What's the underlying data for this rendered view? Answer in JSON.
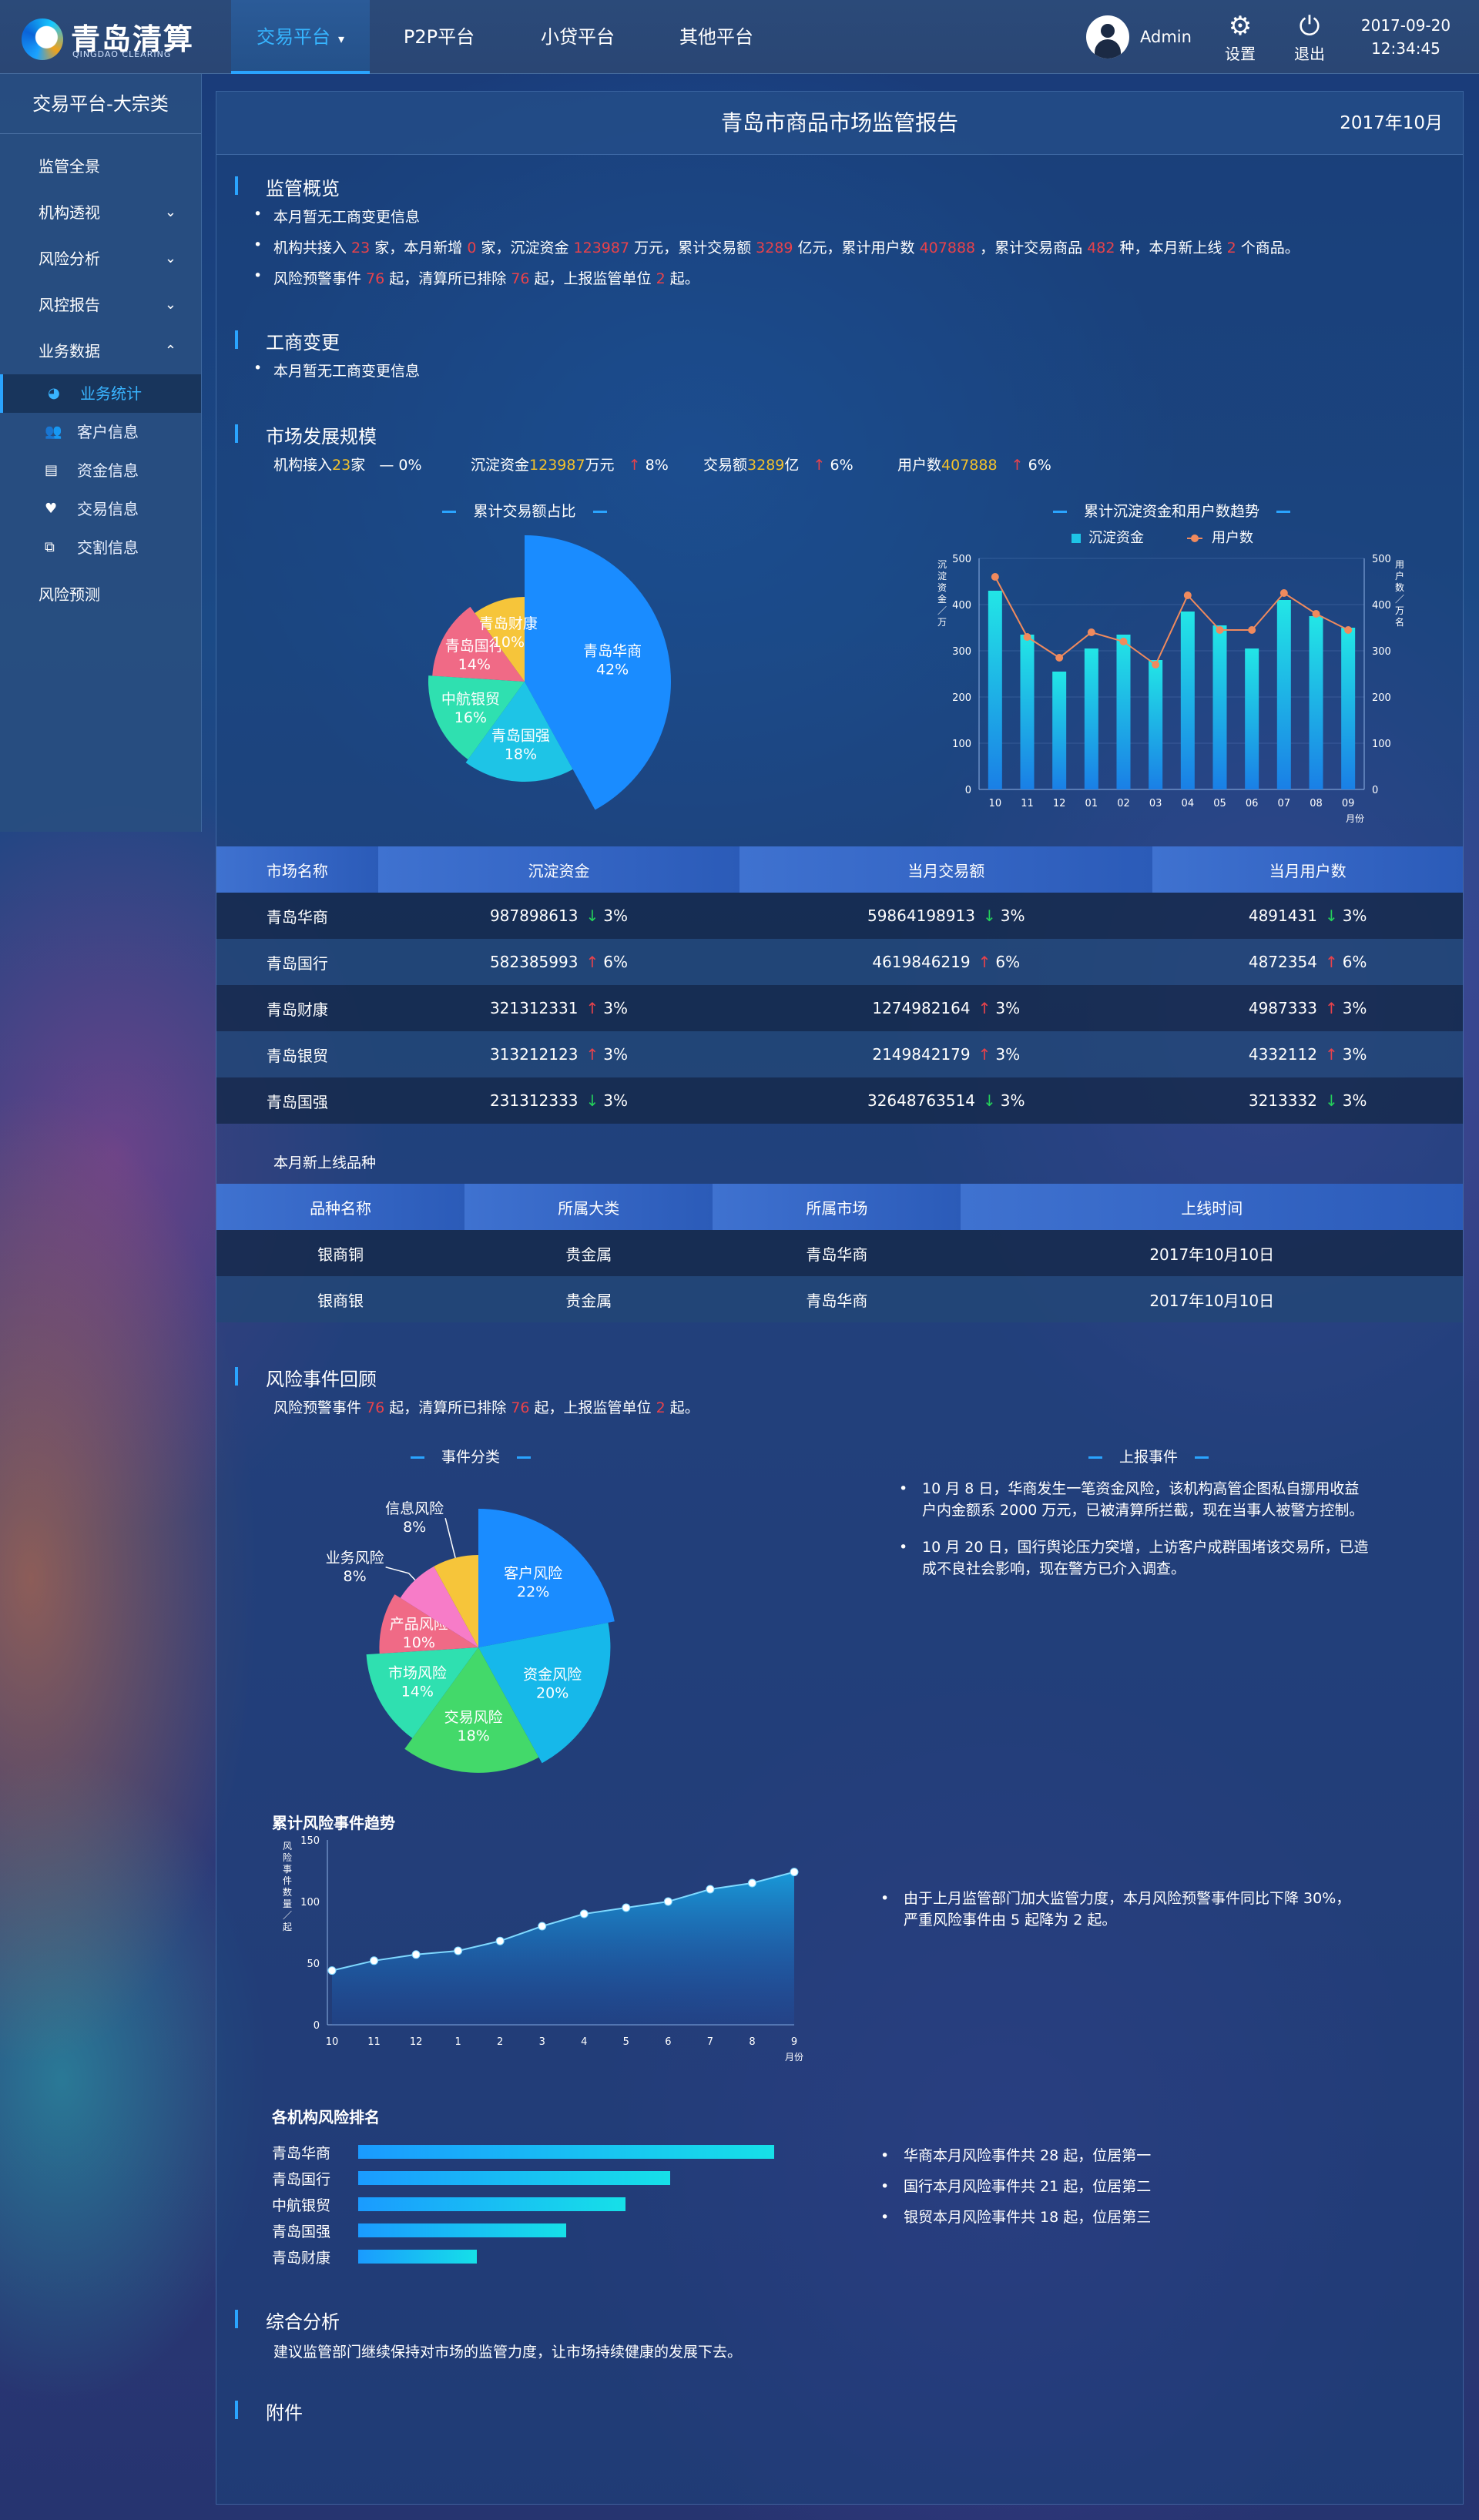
{
  "header": {
    "logo_name": "青岛清算",
    "logo_sub": "QINGDAO CLEARING",
    "nav": [
      {
        "label": "交易平台",
        "active": true
      },
      {
        "label": "P2P平台",
        "active": false
      },
      {
        "label": "小贷平台",
        "active": false
      },
      {
        "label": "其他平台",
        "active": false
      }
    ],
    "user": "Admin",
    "settings_label": "设置",
    "logout_label": "退出",
    "date": "2017-09-20",
    "time": "12:34:45"
  },
  "sidebar": {
    "title": "交易平台-大宗类",
    "items": [
      {
        "label": "监管全景",
        "has_children": false
      },
      {
        "label": "机构透视",
        "has_children": true
      },
      {
        "label": "风险分析",
        "has_children": true
      },
      {
        "label": "风控报告",
        "has_children": true
      },
      {
        "label": "业务数据",
        "has_children": true
      }
    ],
    "sub_items": [
      {
        "label": "业务统计",
        "icon": "pie-icon",
        "active": true
      },
      {
        "label": "客户信息",
        "icon": "users-icon",
        "active": false
      },
      {
        "label": "资金信息",
        "icon": "ledger-icon",
        "active": false
      },
      {
        "label": "交易信息",
        "icon": "handshake-icon",
        "active": false
      },
      {
        "label": "交割信息",
        "icon": "exchange-icon",
        "active": false
      }
    ],
    "last_item": "风险预测"
  },
  "report": {
    "title": "青岛市商品市场监管报告",
    "month": "2017年10月",
    "overview": {
      "heading": "监管概览",
      "line1": "本月暂无工商变更信息",
      "line2": {
        "t1": "机构共接入 ",
        "v1": "23",
        "t2": " 家，本月新增 ",
        "v2": "0",
        "t3": " 家，沉淀资金 ",
        "v3": "123987",
        "t4": " 万元，累计交易额 ",
        "v4": "3289",
        "t5": " 亿元，累计用户数 ",
        "v5": "407888",
        "t6": " ，累计交易商品 ",
        "v6": "482",
        "t7": " 种，本月新上线 ",
        "v7": "2",
        "t8": " 个商品。"
      },
      "line3": {
        "t1": "风险预警事件 ",
        "v1": "76",
        "t2": " 起，清算所已排除 ",
        "v2": "76",
        "t3": " 起，上报监管单位 ",
        "v3": "2",
        "t4": " 起。"
      }
    },
    "business_change": {
      "heading": "工商变更",
      "line": "本月暂无工商变更信息"
    },
    "market": {
      "heading": "市场发展规模",
      "kpis": [
        {
          "label": "机构接入",
          "value": "23",
          "unit": "家",
          "trend": "—",
          "pct": "0%"
        },
        {
          "label": "沉淀资金",
          "value": "123987",
          "unit": "万元",
          "trend": "↑",
          "pct": "8%"
        },
        {
          "label": "交易额",
          "value": "3289",
          "unit": "亿",
          "trend": "↑",
          "pct": "6%"
        },
        {
          "label": "用户数",
          "value": "407888",
          "unit": "",
          "trend": "↑",
          "pct": "6%"
        }
      ]
    },
    "new_products_heading": "本月新上线品种",
    "risk": {
      "heading": "风险事件回顾",
      "line": {
        "t1": "风险预警事件 ",
        "v1": "76",
        "t2": " 起，清算所已排除 ",
        "v2": "76",
        "t3": " 起，上报监管单位 ",
        "v3": "2",
        "t4": " 起。"
      },
      "reported_title": "上报事件",
      "reported": [
        [
          "10 月 8 日，华商发生一笔资金风险，该机构高管企图私自挪用收益",
          "户内金额系 2000 万元，已被清算所拦截，现在当事人被警方控制。"
        ],
        [
          "10 月 20 日，国行舆论压力突增，上访客户成群围堵该交易所，已造",
          "成不良社会影响，现在警方已介入调查。"
        ]
      ],
      "trend_title": "累计风险事件趋势",
      "trend_note": [
        "由于上月监管部门加大监管力度，本月风险预警事件同比下降 30%，",
        "严重风险事件由 5 起降为 2 起。"
      ],
      "ranking_title": "各机构风险排名",
      "ranking": [
        {
          "name": "青岛华商",
          "value": 28
        },
        {
          "name": "青岛国行",
          "value": 21
        },
        {
          "name": "中航银贸",
          "value": 18
        },
        {
          "name": "青岛国强",
          "value": 14
        },
        {
          "name": "青岛财康",
          "value": 8
        }
      ],
      "ranking_notes": [
        "华商本月风险事件共 28 起，位居第一",
        "国行本月风险事件共 21 起，位居第二",
        "银贸本月风险事件共 18 起，位居第三"
      ]
    },
    "summary": {
      "heading": "综合分析",
      "line": "建议监管部门继续保持对市场的监管力度，让市场持续健康的发展下去。"
    },
    "attachment": {
      "heading": "附件"
    }
  },
  "market_table": {
    "headers": [
      "市场名称",
      "沉淀资金",
      "当月交易额",
      "当月用户数"
    ],
    "rows": [
      {
        "name": "青岛华商",
        "fund": "987898613",
        "fund_dir": "down",
        "fund_pct": "3%",
        "trade": "59864198913",
        "trade_dir": "down",
        "trade_pct": "3%",
        "users": "4891431",
        "users_dir": "down",
        "users_pct": "3%"
      },
      {
        "name": "青岛国行",
        "fund": "582385993",
        "fund_dir": "up",
        "fund_pct": "6%",
        "trade": "4619846219",
        "trade_dir": "up",
        "trade_pct": "6%",
        "users": "4872354",
        "users_dir": "up",
        "users_pct": "6%"
      },
      {
        "name": "青岛财康",
        "fund": "321312331",
        "fund_dir": "up",
        "fund_pct": "3%",
        "trade": "1274982164",
        "trade_dir": "up",
        "trade_pct": "3%",
        "users": "4987333",
        "users_dir": "up",
        "users_pct": "3%"
      },
      {
        "name": "青岛银贸",
        "fund": "313212123",
        "fund_dir": "up",
        "fund_pct": "3%",
        "trade": "2149842179",
        "trade_dir": "up",
        "trade_pct": "3%",
        "users": "4332112",
        "users_dir": "up",
        "users_pct": "3%"
      },
      {
        "name": "青岛国强",
        "fund": "231312333",
        "fund_dir": "down",
        "fund_pct": "3%",
        "trade": "32648763514",
        "trade_dir": "down",
        "trade_pct": "3%",
        "users": "3213332",
        "users_dir": "down",
        "users_pct": "3%"
      }
    ]
  },
  "product_table": {
    "headers": [
      "品种名称",
      "所属大类",
      "所属市场",
      "上线时间"
    ],
    "rows": [
      [
        "银商铜",
        "贵金属",
        "青岛华商",
        "2017年10月10日"
      ],
      [
        "银商银",
        "贵金属",
        "青岛华商",
        "2017年10月10日"
      ]
    ]
  },
  "colors": {
    "accent": "#2aa4ff",
    "red": "#e8424b",
    "yellow": "#f3c12b",
    "green": "#24d05a"
  },
  "chart_data": [
    {
      "type": "pie",
      "title": "累计交易额占比",
      "slices": [
        {
          "label": "青岛华商",
          "value": 42,
          "color": "#1a8cff"
        },
        {
          "label": "青岛国强",
          "value": 18,
          "color": "#1ec4e6"
        },
        {
          "label": "中航银贸",
          "value": 16,
          "color": "#2fe0b0"
        },
        {
          "label": "青岛国行",
          "value": 14,
          "color": "#f06a86"
        },
        {
          "label": "青岛财康",
          "value": 10,
          "color": "#f6c53a"
        }
      ]
    },
    {
      "type": "bar+line",
      "title": "累计沉淀资金和用户数趋势",
      "categories": [
        "10",
        "11",
        "12",
        "01",
        "02",
        "03",
        "04",
        "05",
        "06",
        "07",
        "08",
        "09"
      ],
      "series": [
        {
          "name": "沉淀资金",
          "type": "bar",
          "values": [
            430,
            335,
            255,
            305,
            335,
            280,
            385,
            355,
            305,
            410,
            375,
            350
          ]
        },
        {
          "name": "用户数",
          "type": "line",
          "values": [
            460,
            330,
            285,
            340,
            320,
            270,
            420,
            345,
            345,
            425,
            380,
            345
          ]
        }
      ],
      "ylabel_left": "沉淀资金／万",
      "ylabel_right": "用户数／万名",
      "xlabel": "月份",
      "ylim": [
        0,
        500
      ],
      "yticks": [
        0,
        100,
        200,
        300,
        400,
        500
      ]
    },
    {
      "type": "pie",
      "title": "事件分类",
      "slices": [
        {
          "label": "客户风险",
          "value": 22,
          "color": "#1a8cff"
        },
        {
          "label": "资金风险",
          "value": 20,
          "color": "#16b8ea"
        },
        {
          "label": "交易风险",
          "value": 18,
          "color": "#43d96a"
        },
        {
          "label": "市场风险",
          "value": 14,
          "color": "#2fe0b0"
        },
        {
          "label": "产品风险",
          "value": 10,
          "color": "#f06a86"
        },
        {
          "label": "业务风险",
          "value": 8,
          "color": "#f77cc8"
        },
        {
          "label": "信息风险",
          "value": 8,
          "color": "#f6c53a"
        }
      ]
    },
    {
      "type": "area",
      "title": "累计风险事件趋势",
      "categories": [
        "10",
        "11",
        "12",
        "1",
        "2",
        "3",
        "4",
        "5",
        "6",
        "7",
        "8",
        "9"
      ],
      "values": [
        44,
        52,
        57,
        60,
        68,
        80,
        90,
        95,
        100,
        110,
        115,
        124
      ],
      "ylabel": "风险事件数量／起",
      "xlabel": "月份",
      "ylim": [
        0,
        150
      ],
      "yticks": [
        0,
        50,
        100,
        150
      ]
    },
    {
      "type": "bar",
      "orientation": "horizontal",
      "title": "各机构风险排名",
      "categories": [
        "青岛华商",
        "青岛国行",
        "中航银贸",
        "青岛国强",
        "青岛财康"
      ],
      "values": [
        28,
        21,
        18,
        14,
        8
      ]
    }
  ]
}
